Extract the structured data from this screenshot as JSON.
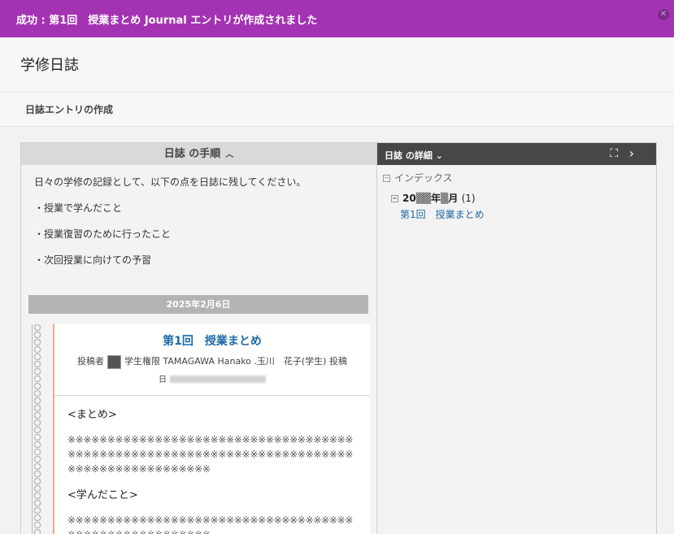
{
  "banner": {
    "message": "成功 : 第1回　授業まとめ Journal エントリが作成されました",
    "close_icon": "close-circle-icon"
  },
  "page": {
    "title": "学修日誌",
    "subtitle": "日誌エントリの作成"
  },
  "instructions": {
    "header": "日誌 の手順",
    "intro": "日々の学修の記録として、以下の点を日誌に残してください。",
    "items": [
      "・授業で学んだこと",
      "・授業復習のために行ったこと",
      "・次回授業に向けての予習"
    ]
  },
  "entry": {
    "date_header": "2025年2月6日",
    "title": "第1回　授業まとめ",
    "author_prefix": "投稿者",
    "author": "学生権限 TAMAGAWA Hanako .玉川　花子(学生)",
    "posted_suffix": "投稿",
    "posted_date_prefix": "日",
    "section1_heading": "<まとめ>",
    "section1_text": "※※※※※※※※※※※※※※※※※※※※※※※※※※※※※※※※※※※※※※※※※※※※※※※※※※※※※※※※※※※※※※※※※※※※※※※※※※※※※※※※※※※※※※※※※※",
    "section2_heading": "<学んだこと>",
    "section2_text": "※※※※※※※※※※※※※※※※※※※※※※※※※※※※※※※※※※※※※※※※※※※※※※※※※※※※※※"
  },
  "details": {
    "header": "日誌 の詳細",
    "index_label": "インデックス",
    "month_label": "20▒▒年▒月",
    "month_count": "(1)",
    "entry_link": "第1回　授業まとめ"
  }
}
